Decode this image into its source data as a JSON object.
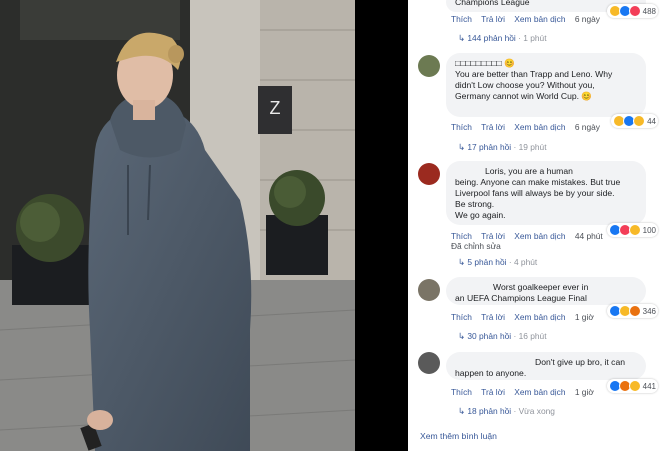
{
  "photo": {
    "sign_letter": "Z"
  },
  "comments": [
    {
      "id": "c0",
      "text_lines": [
        "Champions League"
      ],
      "actions": {
        "like": "Thích",
        "reply": "Trả lời",
        "translate": "Xem bản dịch",
        "time": "6 ngày"
      },
      "reactions": {
        "count": "488"
      },
      "replies": {
        "label": "144 phản hồi",
        "time": "1 phút"
      }
    },
    {
      "id": "c1",
      "text_lines": [
        "□□□□□□□□□ 😊",
        "You are better than Trapp and Leno. Why",
        "didn't Low choose you? Without you,",
        "Germany cannot win World Cup. 😊"
      ],
      "actions": {
        "like": "Thích",
        "reply": "Trả lời",
        "translate": "Xem bản dịch",
        "time": "6 ngày"
      },
      "reactions": {
        "count": "44"
      },
      "replies": {
        "label": "17 phản hồi",
        "time": "19 phút"
      }
    },
    {
      "id": "c2",
      "text_lines": [
        "Loris, you are a human",
        "being. Anyone can make mistakes. But true",
        "Liverpool fans will always be by your side.",
        "Be strong.",
        "We go again."
      ],
      "actions": {
        "like": "Thích",
        "reply": "Trả lời",
        "translate": "Xem bản dịch",
        "time": "44 phút",
        "edited": "Đã chỉnh sửa"
      },
      "reactions": {
        "count": "100"
      },
      "replies": {
        "label": "5 phản hồi",
        "time": "4 phút"
      }
    },
    {
      "id": "c3",
      "text_lines": [
        "Worst goalkeeper ever in",
        "an UEFA Champions League Final"
      ],
      "actions": {
        "like": "Thích",
        "reply": "Trả lời",
        "translate": "Xem bản dịch",
        "time": "1 giờ"
      },
      "reactions": {
        "count": "346"
      },
      "replies": {
        "label": "30 phản hồi",
        "time": "16 phút"
      }
    },
    {
      "id": "c4",
      "text_lines": [
        "Don't give up bro, it can",
        "happen to anyone."
      ],
      "actions": {
        "like": "Thích",
        "reply": "Trả lời",
        "translate": "Xem bản dịch",
        "time": "1 giờ"
      },
      "reactions": {
        "count": "441"
      },
      "replies": {
        "label": "18 phản hồi",
        "time": "Vừa xong"
      }
    }
  ],
  "more_comments": "Xem thêm bình luận",
  "colors": {
    "link": "#385898",
    "bubble": "#f2f3f5",
    "muted": "#90949c"
  }
}
